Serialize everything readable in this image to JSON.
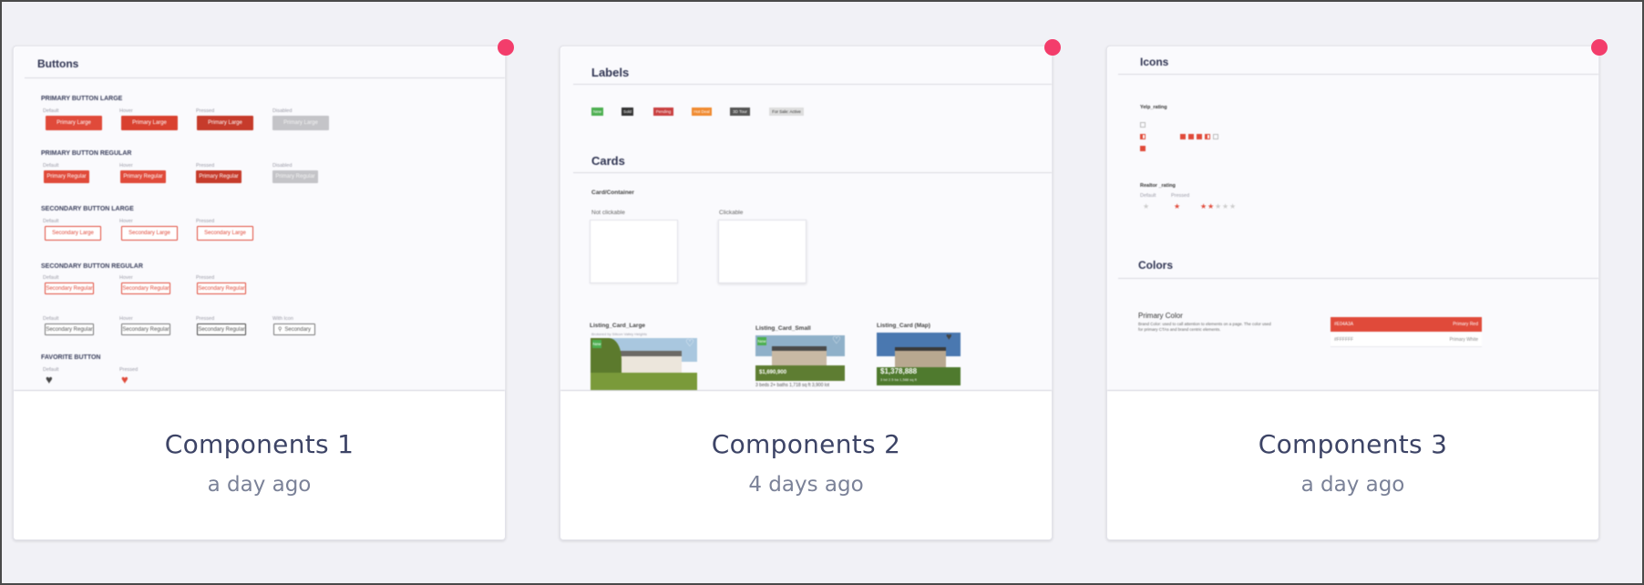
{
  "cards": [
    {
      "title": "Components 1",
      "time": "a day ago",
      "thumb": {
        "heading": "Buttons",
        "sections": {
          "primary_large": "PRIMARY BUTTON LARGE",
          "primary_regular": "PRIMARY BUTTON REGULAR",
          "secondary_large": "SECONDARY BUTTON LARGE",
          "secondary_regular": "SECONDARY BUTTON REGULAR",
          "favorite": "FAVORITE BUTTON"
        },
        "states": {
          "default": "Default",
          "hover": "Hover",
          "pressed": "Pressed",
          "disabled": "Disabled",
          "with_icon": "With Icon"
        },
        "labels": {
          "primary_large": "Primary Large",
          "primary_regular": "Primary Regular",
          "secondary_large": "Secondary Large",
          "secondary_regular": "Secondary Regular",
          "secondary": "Secondary"
        }
      }
    },
    {
      "title": "Components 2",
      "time": "4 days ago",
      "thumb": {
        "heading_labels": "Labels",
        "heading_cards": "Cards",
        "badges": [
          "New",
          "Sold",
          "Pending",
          "Hot Deal",
          "3D Tour",
          "For Sale: Active"
        ],
        "card_container": "Card/Container",
        "not_clickable": "Not clickable",
        "clickable": "Clickable",
        "listing_large": "Listing_Card_Large",
        "listing_large_sub": "Brokered by Silicon Valley Heights",
        "listing_small": "Listing_Card_Small",
        "listing_map": "Listing_Card (Map)",
        "price_small": "$1,690,900",
        "price_map": "$1,378,888",
        "specs_small": "3 beds  2+ baths  1,718 sq ft  3,900 lot",
        "specs_map": "3 bd   2.5 ba   1,588 sq ft"
      }
    },
    {
      "title": "Components 3",
      "time": "a day ago",
      "thumb": {
        "heading_icons": "Icons",
        "yelp_rating": "Yelp_rating",
        "realtor_rating": "Realtor _rating",
        "default": "Default",
        "pressed": "Pressed",
        "heading_colors": "Colors",
        "primary_color": "Primary Color",
        "primary_color_desc": "Brand Color: used to call attention to elements on a page. The color used for primary CTAs and brand centric elements.",
        "red_hex": "#E04A3A",
        "red_name": "Primary Red",
        "white_hex": "#FFFFFF",
        "white_name": "Primary White"
      }
    }
  ],
  "colors": {
    "background": "#f1f1f6",
    "dot": "#f33d6b",
    "title": "#3d4466",
    "time": "#7b8298",
    "primary": "#e04a3a"
  }
}
